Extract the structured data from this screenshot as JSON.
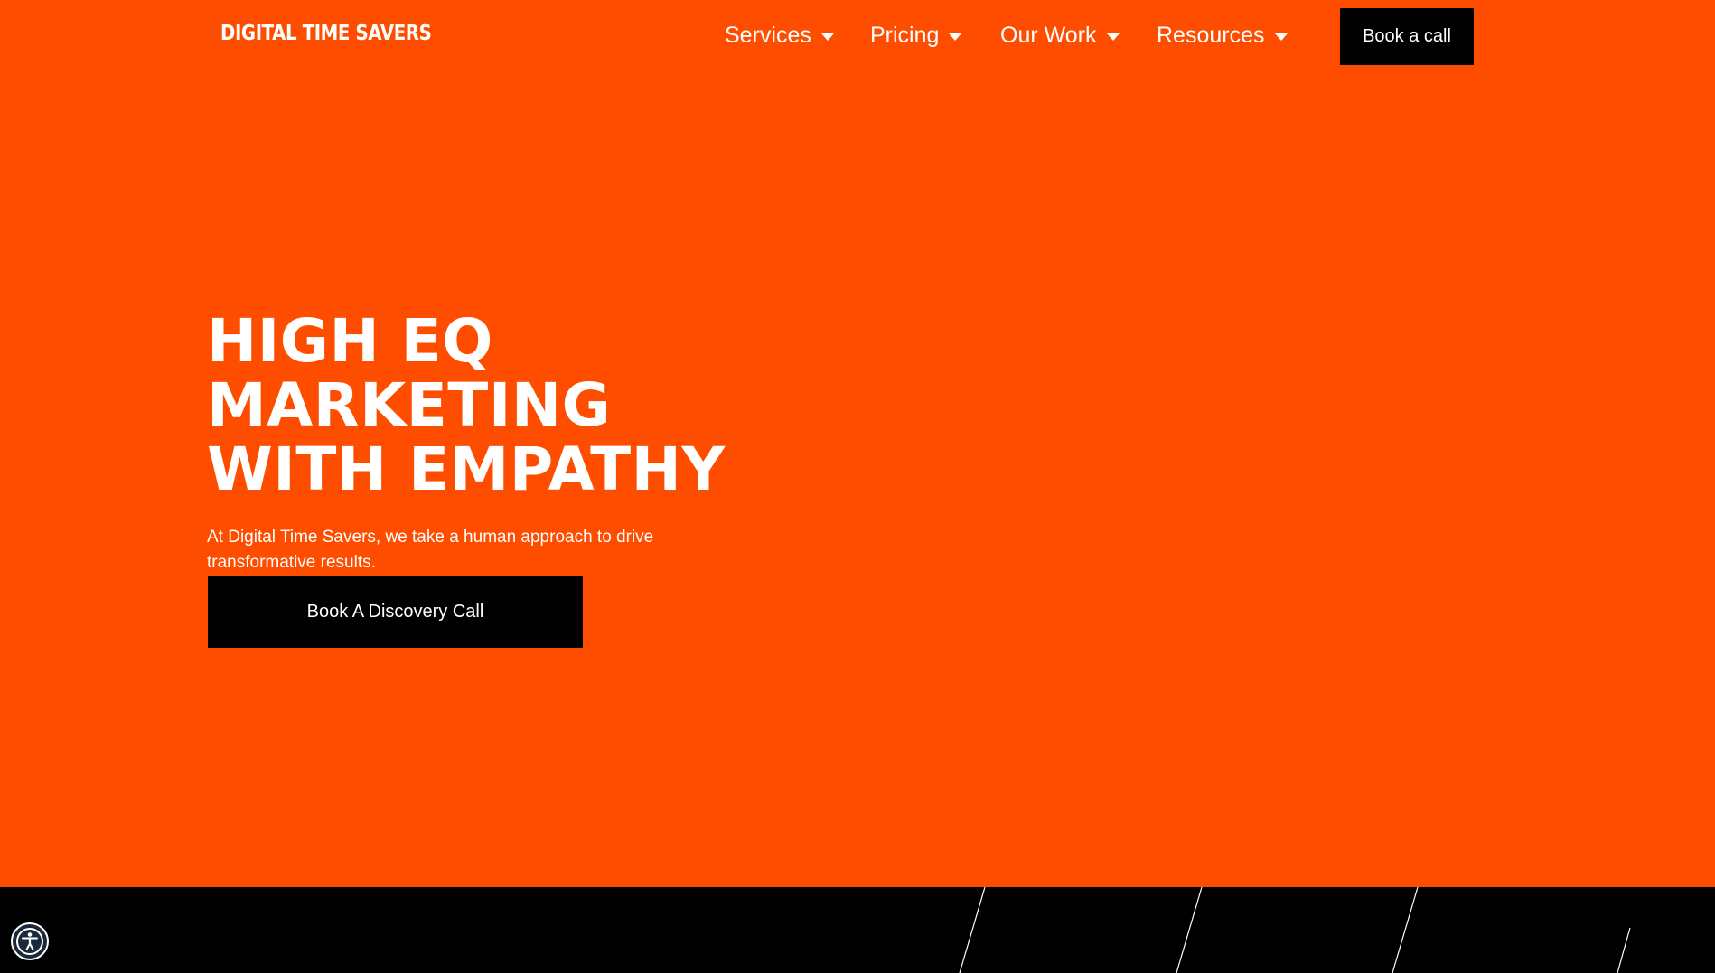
{
  "brand": {
    "logo_text": "DIGITAL TIME SAVERS",
    "accent_color": "#FF4D00",
    "dark_color": "#000000"
  },
  "nav": {
    "items": [
      {
        "label": "Services",
        "icon": "caret-down-icon"
      },
      {
        "label": "Pricing",
        "icon": "caret-down-icon"
      },
      {
        "label": "Our Work",
        "icon": "caret-down-icon"
      },
      {
        "label": "Resources",
        "icon": "caret-down-icon"
      }
    ],
    "cta_label": "Book a call"
  },
  "hero": {
    "headline_lines": [
      "HIGH EQ",
      "MARKETING",
      "WITH EMPATHY"
    ],
    "subtext": "At Digital Time Savers, we take a human approach to drive transformative results.",
    "cta_label": "Book A Discovery Call"
  },
  "widgets": {
    "accessibility_icon": "accessibility-icon"
  }
}
